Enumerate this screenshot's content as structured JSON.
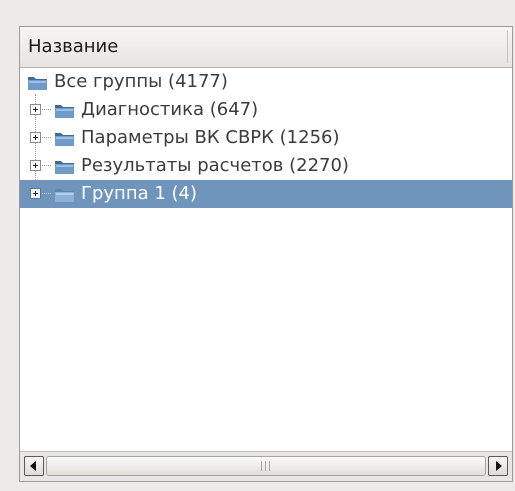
{
  "header": {
    "column_title": "Название"
  },
  "tree": {
    "root": {
      "label": "Все группы (4177)",
      "icon": "folder-icon"
    },
    "children": [
      {
        "label": "Диагностика (647)",
        "icon": "folder-icon",
        "selected": false
      },
      {
        "label": "Параметры ВК СВРК (1256)",
        "icon": "folder-icon",
        "selected": false
      },
      {
        "label": "Результаты расчетов (2270)",
        "icon": "folder-icon",
        "selected": false
      },
      {
        "label": "Группа 1 (4)",
        "icon": "folder-icon",
        "selected": true
      }
    ]
  },
  "colors": {
    "selection": "#6f95bd",
    "folder_dark": "#3f6b95",
    "folder_light": "#7fa9d1"
  },
  "scrollbar": {
    "left_icon": "arrow-left-icon",
    "right_icon": "arrow-right-icon",
    "grip_icon": "grip-icon"
  }
}
